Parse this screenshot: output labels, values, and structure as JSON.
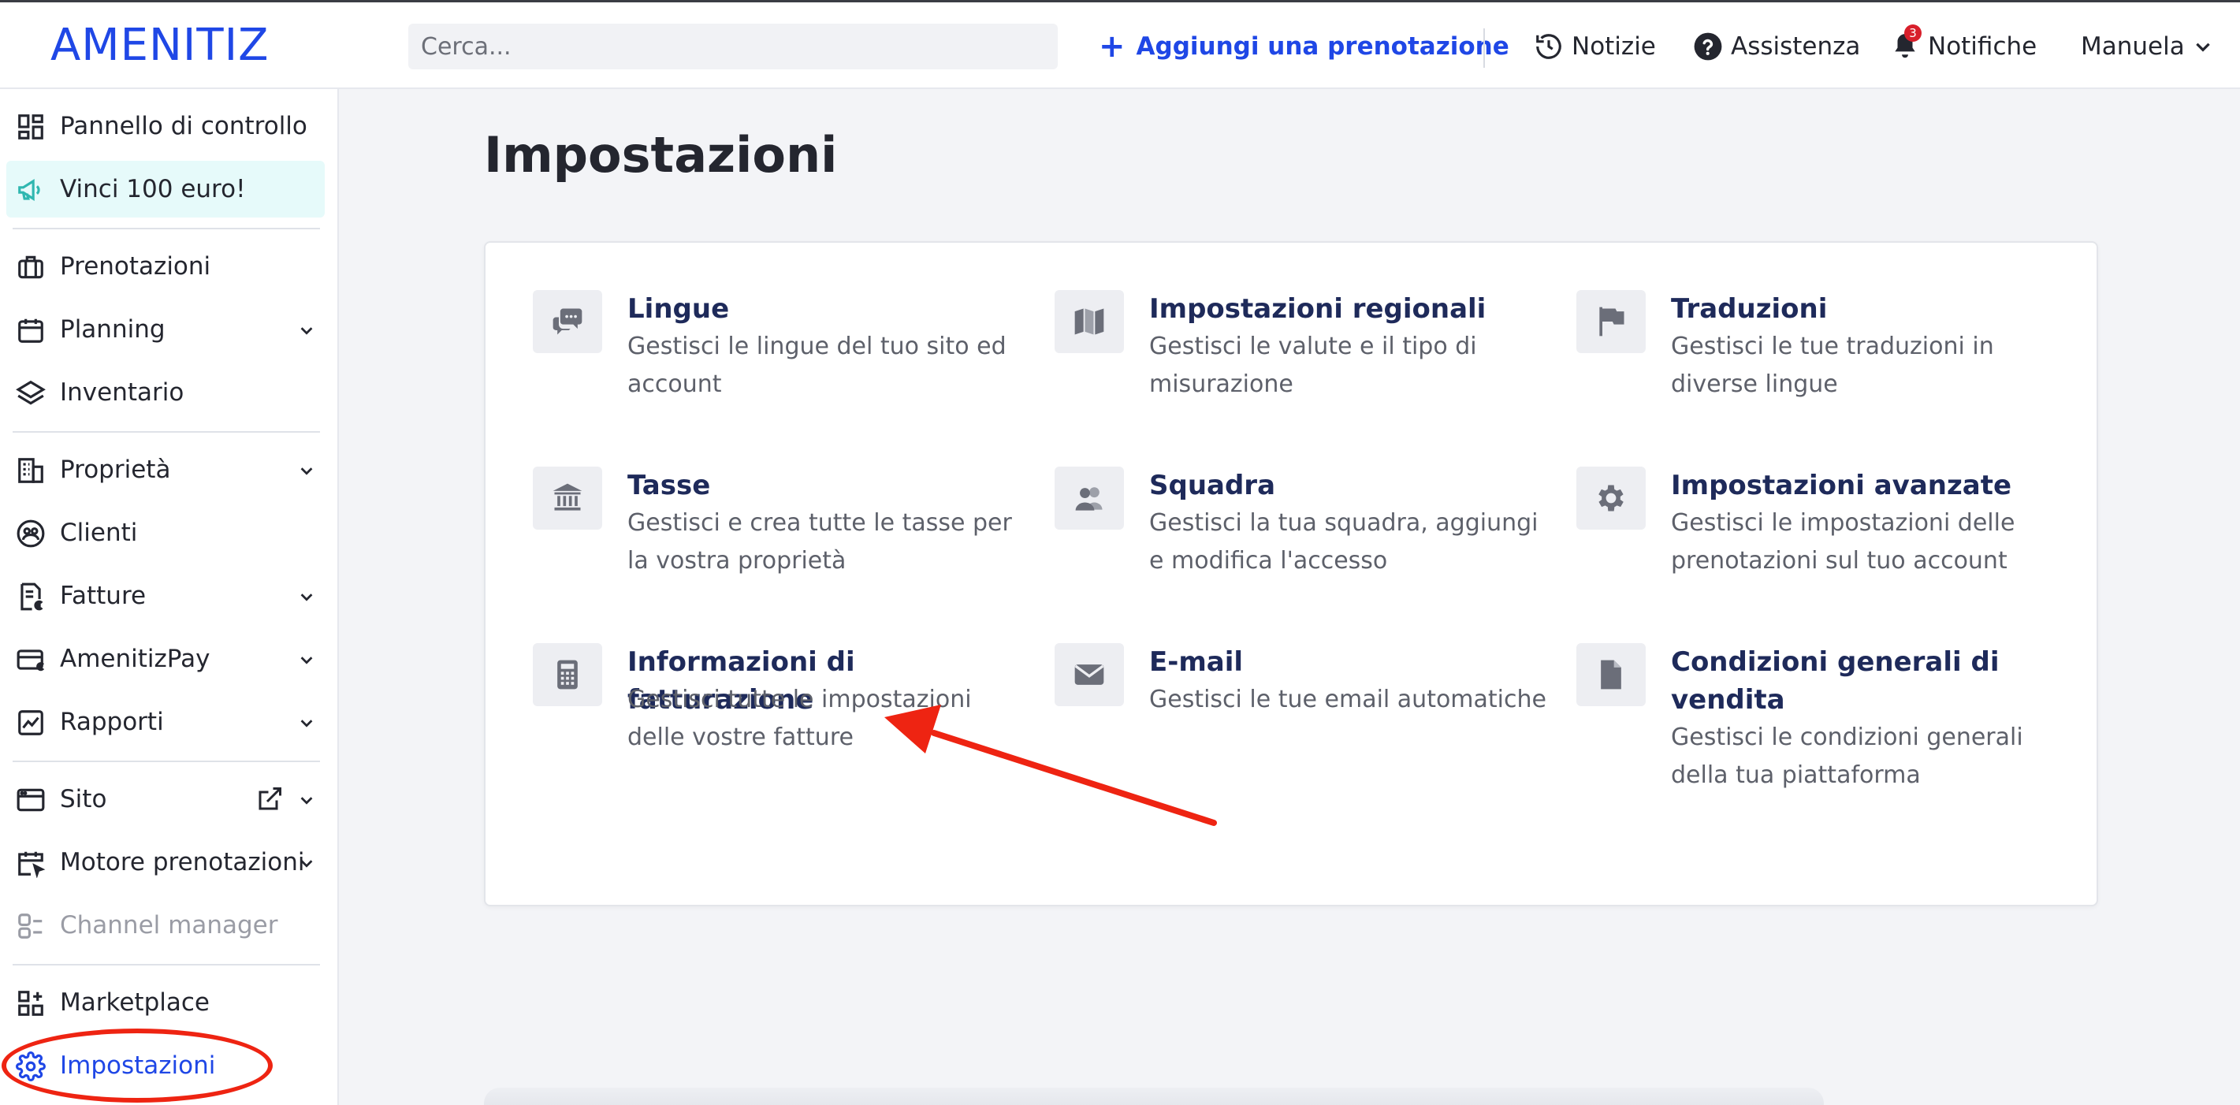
{
  "header": {
    "logo": "AMENITIZ",
    "search_placeholder": "Cerca...",
    "add_booking": "Aggiungi una prenotazione",
    "news": "Notizie",
    "help": "Assistenza",
    "notifications": "Notifiche",
    "notifications_count": "3",
    "user": "Manuela"
  },
  "sidebar": {
    "items": [
      {
        "label": "Pannello di controllo",
        "icon": "dashboard-icon"
      },
      {
        "label": "Vinci 100 euro!",
        "icon": "megaphone-icon"
      },
      {
        "label": "Prenotazioni",
        "icon": "suitcase-icon"
      },
      {
        "label": "Planning",
        "icon": "calendar-icon"
      },
      {
        "label": "Inventario",
        "icon": "layers-icon"
      },
      {
        "label": "Proprietà",
        "icon": "building-icon"
      },
      {
        "label": "Clienti",
        "icon": "clients-icon"
      },
      {
        "label": "Fatture",
        "icon": "invoice-icon"
      },
      {
        "label": "AmenitizPay",
        "icon": "card-icon"
      },
      {
        "label": "Rapporti",
        "icon": "chart-icon"
      },
      {
        "label": "Sito",
        "icon": "browser-icon"
      },
      {
        "label": "Motore prenotazioni",
        "icon": "booking-engine-icon"
      },
      {
        "label": "Channel manager",
        "icon": "channel-icon"
      },
      {
        "label": "Marketplace",
        "icon": "marketplace-icon"
      },
      {
        "label": "Impostazioni",
        "icon": "gear-icon"
      }
    ]
  },
  "main": {
    "title": "Impostazioni",
    "tiles": [
      {
        "title": "Lingue",
        "desc1": "Gestisci le lingue del tuo sito ed",
        "desc2": "account",
        "icon": "chat-bubbles-icon"
      },
      {
        "title": "Impostazioni regionali",
        "desc1": "Gestisci le valute e il tipo di",
        "desc2": "misurazione",
        "icon": "map-icon"
      },
      {
        "title": "Traduzioni",
        "desc1": "Gestisci le tue traduzioni in",
        "desc2": "diverse lingue",
        "icon": "flag-icon"
      },
      {
        "title": "Tasse",
        "desc1": "Gestisci e crea tutte le tasse per",
        "desc2": "la vostra proprietà",
        "icon": "bank-icon"
      },
      {
        "title": "Squadra",
        "desc1": "Gestisci la tua squadra, aggiungi",
        "desc2": "e modifica l'accesso",
        "icon": "users-icon"
      },
      {
        "title": "Impostazioni avanzate",
        "desc1": "Gestisci le impostazioni delle",
        "desc2": "prenotazioni sul tuo account",
        "icon": "cog-icon"
      },
      {
        "title": "Informazioni di fatturazione",
        "desc1": "Gestisci tutte le impostazioni",
        "desc2": "delle vostre fatture",
        "icon": "calculator-icon"
      },
      {
        "title": "E-mail",
        "desc1": "Gestisci le tue email automatiche",
        "desc2": "",
        "icon": "envelope-icon"
      },
      {
        "title1": "Condizioni generali di",
        "title2": "vendita",
        "desc1": "Gestisci le condizioni generali",
        "desc2": "della tua piattaforma",
        "icon": "document-icon"
      }
    ]
  },
  "colors": {
    "brand": "#1f47e6",
    "tile_title": "#1e2a5a",
    "annotation": "#ee2412"
  }
}
